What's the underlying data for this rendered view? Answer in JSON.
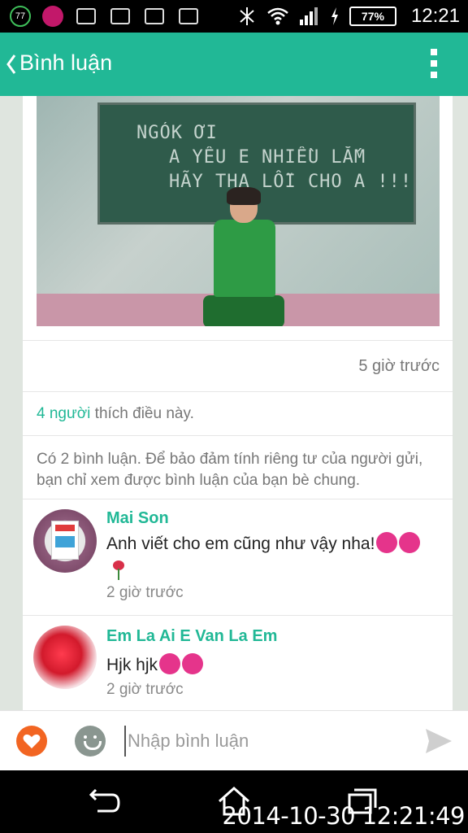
{
  "status_bar": {
    "notification_count": "77",
    "battery": "77%",
    "time": "12:21"
  },
  "header": {
    "title": "Bình luận"
  },
  "post": {
    "board_lines": [
      "NGÓK ƠI",
      "A YÊU E  NHIỀU LẮM",
      "HÃY THA LỖI CHO A !!!"
    ],
    "time": "5 giờ trước",
    "likes_count_text": "4 người",
    "likes_suffix": " thích điều này.",
    "privacy_notice": "Có 2 bình luận. Để bảo đảm tính riêng tư của người gửi, bạn chỉ xem được bình luận của bạn bè chung."
  },
  "comments": [
    {
      "name": "Mai Son",
      "text": "Anh viết cho em cũng như vậy nha!",
      "emojis": [
        "grin",
        "tongue",
        "rose"
      ],
      "time": "2 giờ trước"
    },
    {
      "name": "Em La Ai E Van La Em",
      "text": "Hjk hjk",
      "emojis": [
        "tongue",
        "tongue"
      ],
      "time": "2 giờ trước"
    }
  ],
  "composer": {
    "placeholder": "Nhập bình luận"
  },
  "timestamp_overlay": "2014-10-30 12:21:49",
  "colors": {
    "accent": "#21b896",
    "like_button": "#f26522"
  }
}
